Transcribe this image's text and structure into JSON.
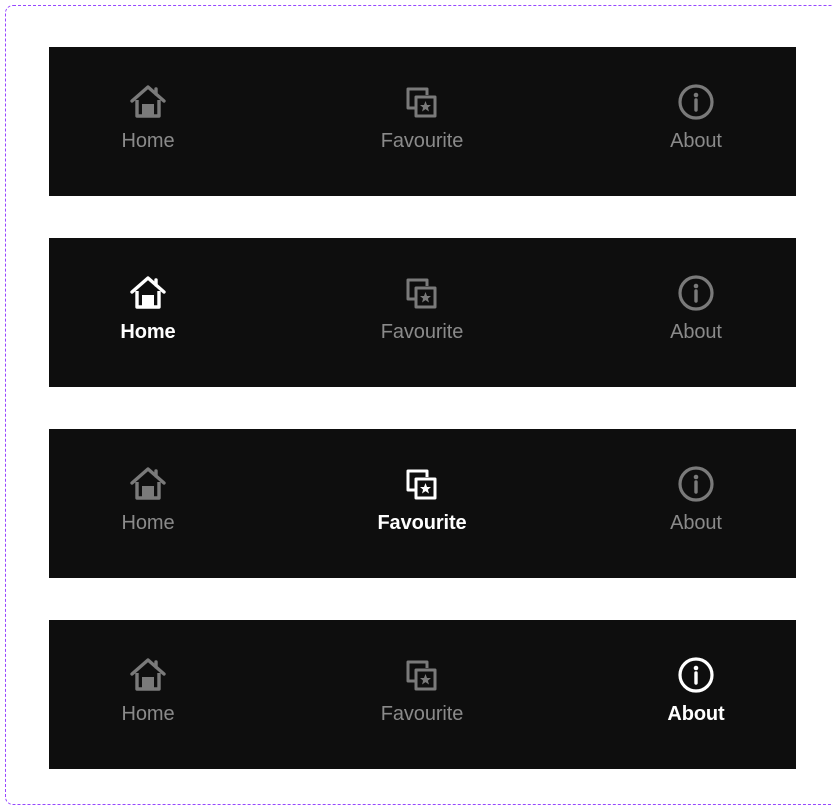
{
  "navbars": [
    {
      "items": [
        {
          "label": "Home",
          "icon": "home-icon",
          "active": false
        },
        {
          "label": "Favourite",
          "icon": "favourite-icon",
          "active": false
        },
        {
          "label": "About",
          "icon": "info-icon",
          "active": false
        }
      ]
    },
    {
      "items": [
        {
          "label": "Home",
          "icon": "home-icon",
          "active": true
        },
        {
          "label": "Favourite",
          "icon": "favourite-icon",
          "active": false
        },
        {
          "label": "About",
          "icon": "info-icon",
          "active": false
        }
      ]
    },
    {
      "items": [
        {
          "label": "Home",
          "icon": "home-icon",
          "active": false
        },
        {
          "label": "Favourite",
          "icon": "favourite-icon",
          "active": true
        },
        {
          "label": "About",
          "icon": "info-icon",
          "active": false
        }
      ]
    },
    {
      "items": [
        {
          "label": "Home",
          "icon": "home-icon",
          "active": false
        },
        {
          "label": "Favourite",
          "icon": "favourite-icon",
          "active": false
        },
        {
          "label": "About",
          "icon": "info-icon",
          "active": true
        }
      ]
    }
  ],
  "colors": {
    "bar_background": "#0e0e0e",
    "active": "#ffffff",
    "inactive_icon": "#7a7a7a",
    "inactive_label": "#8a8a8a",
    "frame_border": "#9747ff"
  }
}
